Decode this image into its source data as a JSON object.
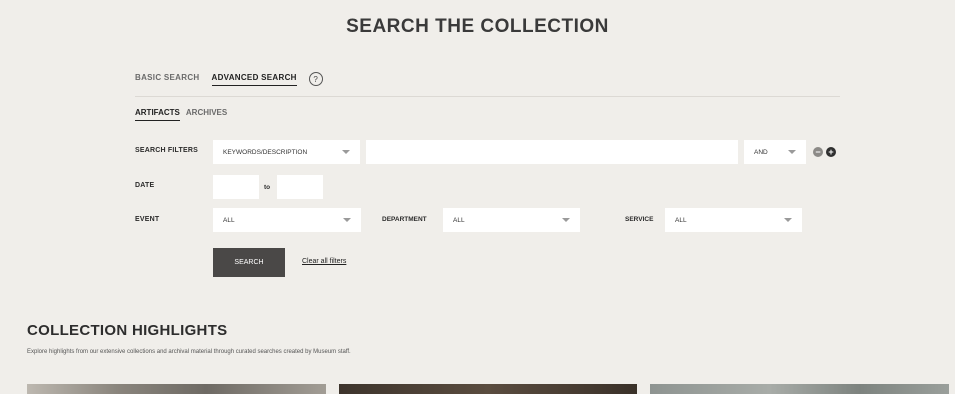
{
  "page": {
    "title": "SEARCH THE COLLECTION"
  },
  "search_tabs": {
    "basic": "BASIC SEARCH",
    "advanced": "ADVANCED SEARCH",
    "help_glyph": "?"
  },
  "type_tabs": {
    "artifacts": "ARTIFACTS",
    "archives": "ARCHIVES"
  },
  "filters": {
    "search_filters_label": "SEARCH FILTERS",
    "field_select": "KEYWORDS/DESCRIPTION",
    "keyword_value": "",
    "operator_select": "AND",
    "remove_glyph": "−",
    "add_glyph": "+"
  },
  "date": {
    "label": "DATE",
    "from_value": "",
    "to_label": "to",
    "to_value": ""
  },
  "event": {
    "label": "EVENT",
    "value": "ALL"
  },
  "department": {
    "label": "DEPARTMENT",
    "value": "ALL"
  },
  "service": {
    "label": "SERVICE",
    "value": "ALL"
  },
  "actions": {
    "search_label": "SEARCH",
    "clear_label": "Clear all filters"
  },
  "highlights": {
    "title": "COLLECTION HIGHLIGHTS",
    "description": "Explore highlights from our extensive collections and archival material through curated searches created by Museum staff."
  },
  "colors": {
    "background": "#f0eeea",
    "button": "#4a4847",
    "remove_button": "#8c8a87",
    "add_button": "#2f2f2f"
  },
  "icons": [
    "help-icon",
    "remove-filter-icon",
    "add-filter-icon",
    "chevron-down-icon"
  ]
}
